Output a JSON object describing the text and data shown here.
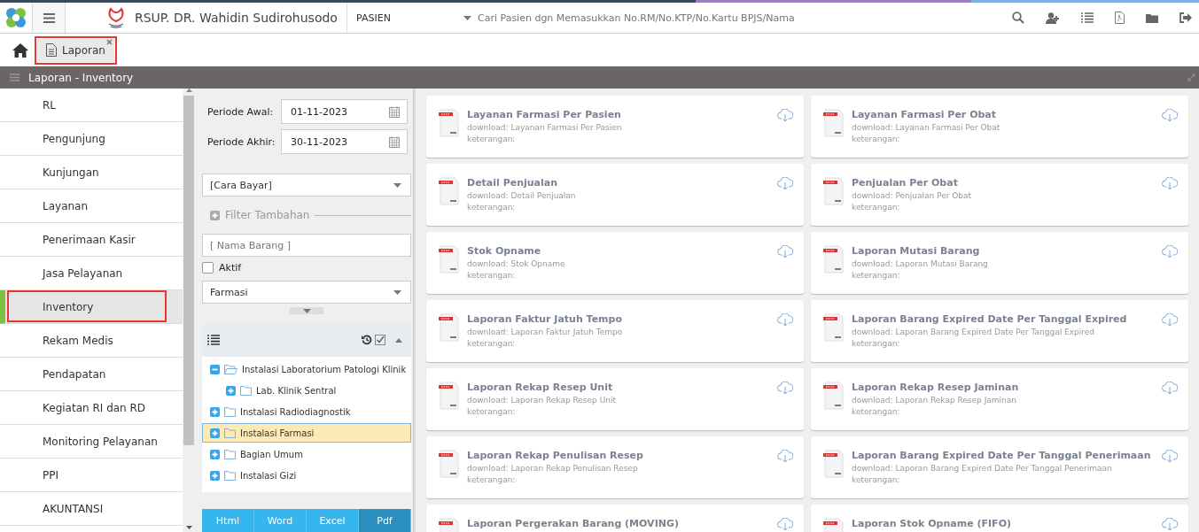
{
  "header": {
    "hospital": "RSUP. DR. Wahidin Sudirohusodo",
    "category": "PASIEN",
    "search_placeholder": "Cari Pasien dgn Memasukkan No.RM/No.KTP/No.Kartu BPJS/Nama"
  },
  "tabs": [
    {
      "label": "Laporan",
      "selected": true
    }
  ],
  "section_title": "Laporan - Inventory",
  "sidebar": {
    "items": [
      {
        "label": "RL",
        "selected": false
      },
      {
        "label": "Pengunjung",
        "selected": false
      },
      {
        "label": "Kunjungan",
        "selected": false
      },
      {
        "label": "Layanan",
        "selected": false
      },
      {
        "label": "Penerimaan Kasir",
        "selected": false
      },
      {
        "label": "Jasa Pelayanan",
        "selected": false
      },
      {
        "label": "Inventory",
        "selected": true
      },
      {
        "label": "Rekam Medis",
        "selected": false
      },
      {
        "label": "Pendapatan",
        "selected": false
      },
      {
        "label": "Kegiatan RI dan RD",
        "selected": false
      },
      {
        "label": "Monitoring Pelayanan",
        "selected": false
      },
      {
        "label": "PPI",
        "selected": false
      },
      {
        "label": "AKUNTANSI",
        "selected": false
      }
    ]
  },
  "filters": {
    "periode_awal": {
      "label": "Periode Awal:",
      "value": "01-11-2023"
    },
    "periode_akhir": {
      "label": "Periode Akhir:",
      "value": "30-11-2023"
    },
    "cara_bayar": "[Cara Bayar]",
    "filter_tambahan": "Filter Tambahan",
    "nama_barang_placeholder": "[ Nama Barang ]",
    "aktif": {
      "label": "Aktif",
      "checked": false
    },
    "jenis": "Farmasi"
  },
  "tree": [
    {
      "label": "Instalasi Laboratorium Patologi Klinik",
      "expanded": true,
      "selected": false,
      "children": [
        {
          "label": "Lab. Klinik Sentral",
          "expanded": false,
          "selected": false
        }
      ]
    },
    {
      "label": "Instalasi Radiodiagnostik",
      "expanded": false,
      "selected": false
    },
    {
      "label": "Instalasi Farmasi",
      "expanded": false,
      "selected": true
    },
    {
      "label": "Bagian Umum",
      "expanded": false,
      "selected": false
    },
    {
      "label": "Instalasi Gizi",
      "expanded": false,
      "selected": false
    }
  ],
  "export_buttons": [
    {
      "label": "Html",
      "selected": false
    },
    {
      "label": "Word",
      "selected": false
    },
    {
      "label": "Excel",
      "selected": false
    },
    {
      "label": "Pdf",
      "selected": true
    }
  ],
  "reports": [
    {
      "title": "Layanan Farmasi Per Pasien",
      "download": "download: Layanan Farmasi Per Pasien",
      "note": "keterangan:"
    },
    {
      "title": "Layanan Farmasi Per Obat",
      "download": "download: Layanan Farmasi Per Obat",
      "note": "keterangan:"
    },
    {
      "title": "Detail Penjualan",
      "download": "download: Detail Penjualan",
      "note": "keterangan:"
    },
    {
      "title": "Penjualan Per Obat",
      "download": "download: Penjualan Per Obat",
      "note": "keterangan:"
    },
    {
      "title": "Stok Opname",
      "download": "download: Stok Opname",
      "note": "keterangan:"
    },
    {
      "title": "Laporan Mutasi Barang",
      "download": "download: Laporan Mutasi Barang",
      "note": "keterangan:"
    },
    {
      "title": "Laporan Faktur Jatuh Tempo",
      "download": "download: Laporan Faktur Jatuh Tempo",
      "note": "keterangan:"
    },
    {
      "title": "Laporan Barang Expired Date Per Tanggal Expired",
      "download": "download: Laporan Barang Expired Date Per Tanggal Expired",
      "note": "keterangan:"
    },
    {
      "title": "Laporan Rekap Resep Unit",
      "download": "download: Laporan Rekap Resep Unit",
      "note": "keterangan:"
    },
    {
      "title": "Laporan Rekap Resep Jaminan",
      "download": "download: Laporan Rekap Resep Jaminan",
      "note": "keterangan:"
    },
    {
      "title": "Laporan Rekap Penulisan Resep",
      "download": "download: Laporan Rekap Penulisan Resep",
      "note": "keterangan:"
    },
    {
      "title": "Laporan Barang Expired Date Per Tanggal Penerimaan",
      "download": "download: Laporan Barang Expired Date Per Tanggal Penerimaan",
      "note": "keterangan:"
    },
    {
      "title": "Laporan Pergerakan Barang (MOVING)"
    },
    {
      "title": "Laporan Stok Opname (FIFO)"
    }
  ]
}
